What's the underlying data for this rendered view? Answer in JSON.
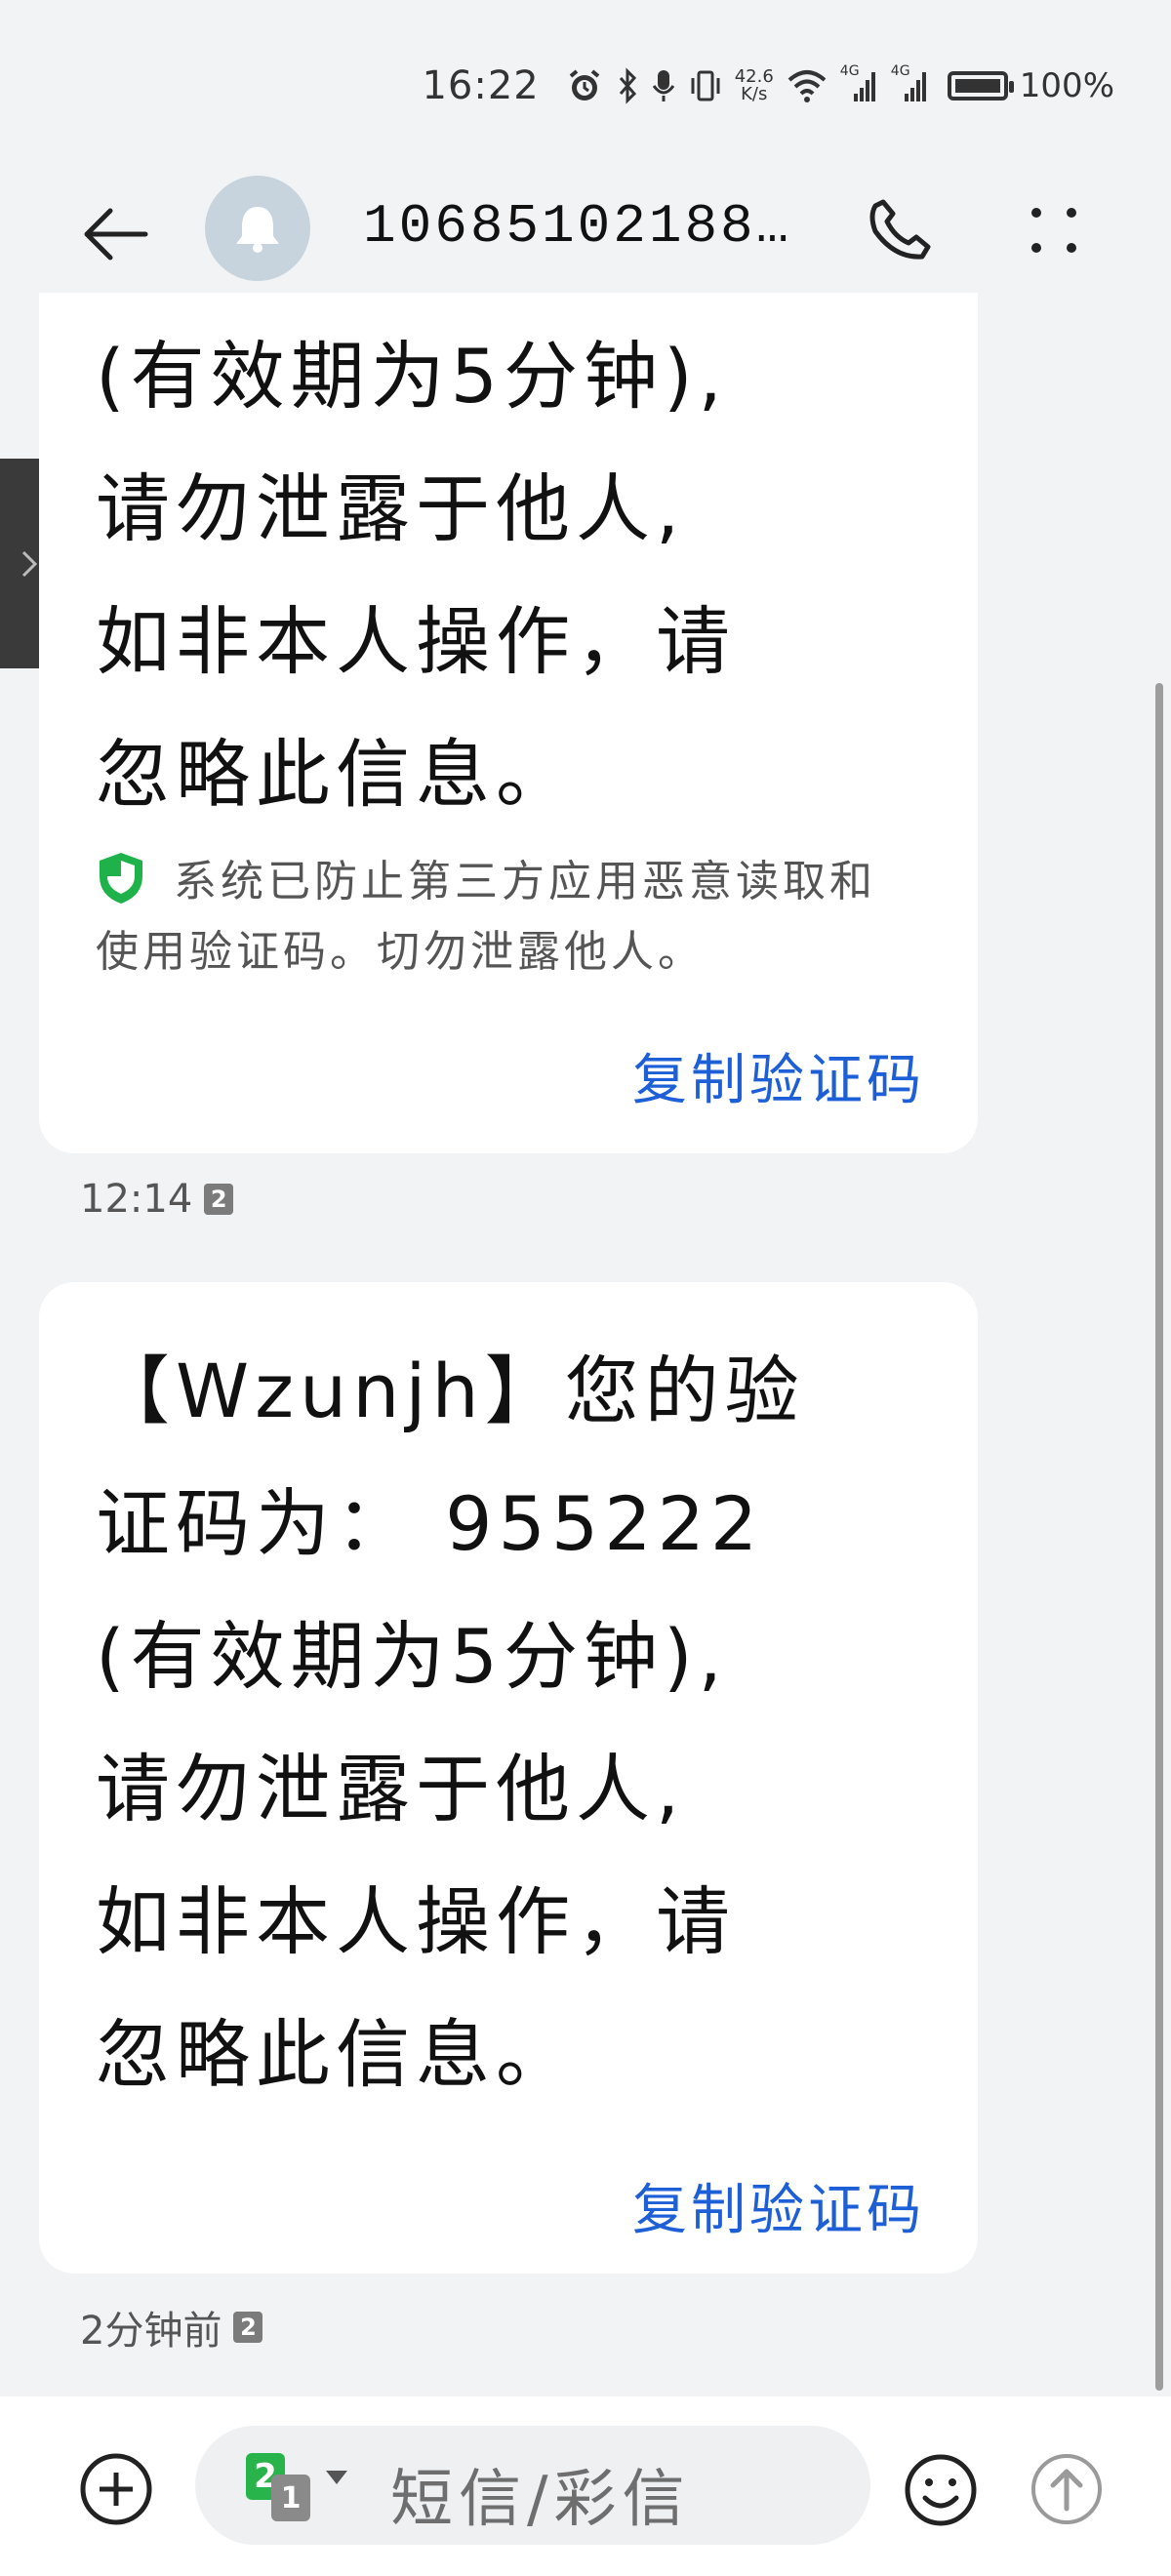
{
  "status_bar": {
    "time": "16:22",
    "net_speed_value": "42.6",
    "net_speed_unit": "K/s",
    "signal_label_1": "4G",
    "signal_label_2": "4G",
    "battery": "100%"
  },
  "header": {
    "title": "106851021880…"
  },
  "messages": [
    {
      "text": "(有效期为5分钟),\n请勿泄露于他人,\n如非本人操作，请\n忽略此信息。",
      "security_note": "系统已防止第三方应用恶意读取和使用验证码。切勿泄露他人。",
      "copy_label": "复制验证码",
      "time": "12:14",
      "sim": "2"
    },
    {
      "text": "【Wzunjh】您的验\n证码为： 955222\n(有效期为5分钟),\n请勿泄露于他人,\n如非本人操作，请\n忽略此信息。",
      "copy_label": "复制验证码",
      "time": "2分钟前",
      "sim": "2"
    }
  ],
  "composer": {
    "placeholder": "短信/彩信",
    "sim_front": "2",
    "sim_back": "1"
  },
  "colors": {
    "accent": "#1d5fd6",
    "shield": "#1fb24a",
    "background": "#f1f3f5"
  }
}
